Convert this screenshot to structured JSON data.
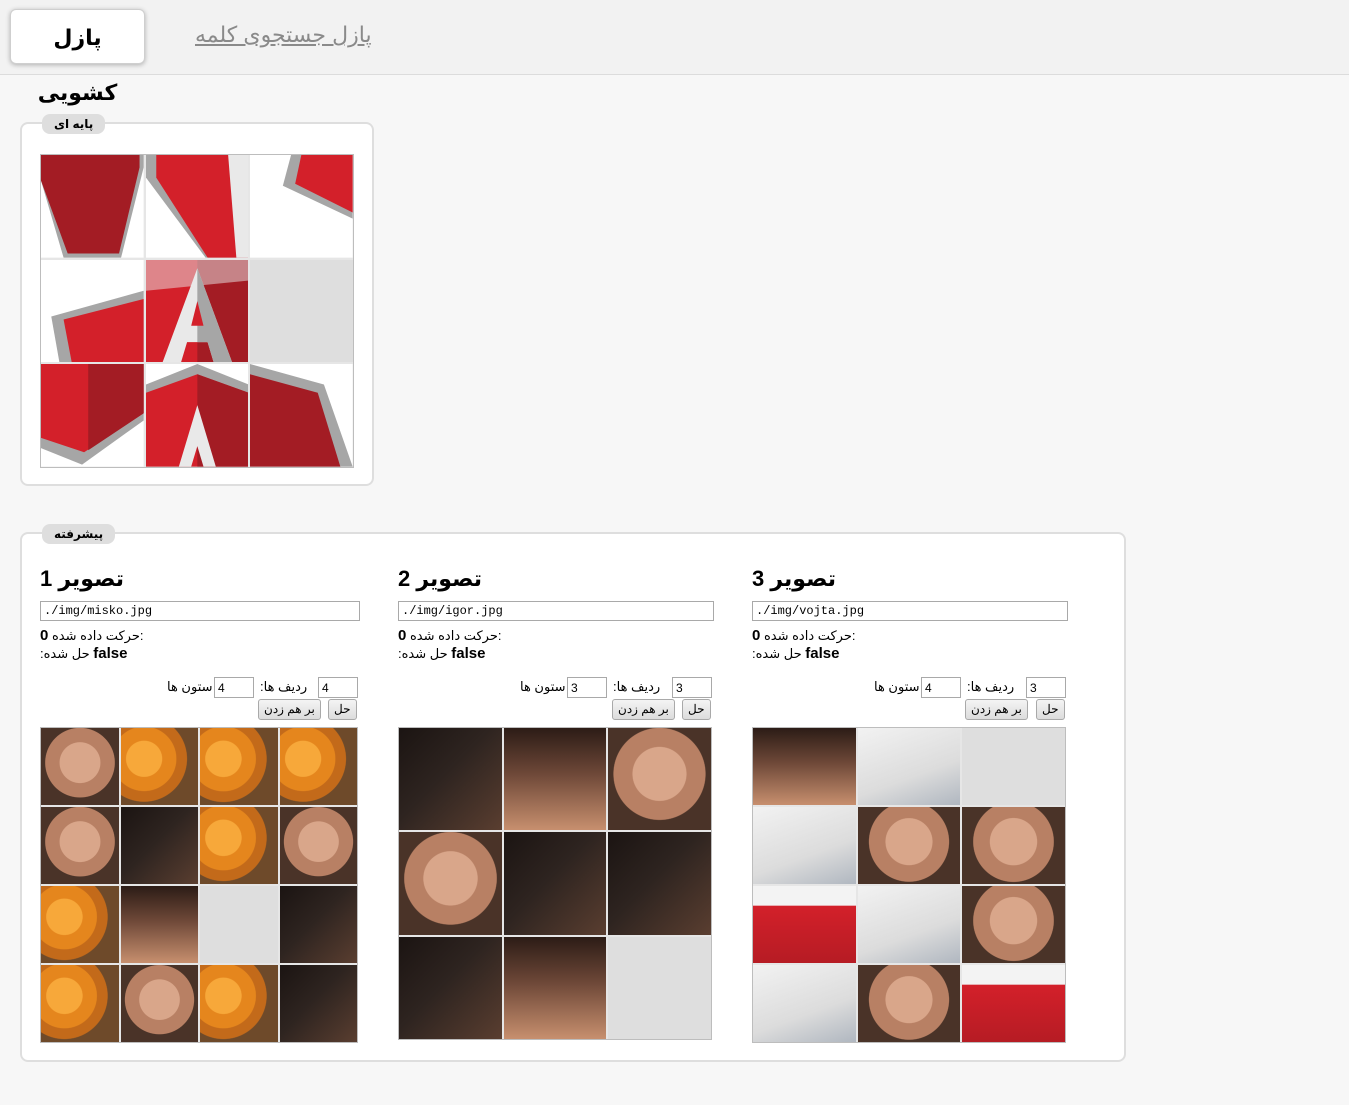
{
  "nav": {
    "active_tab": "پازل کشویی",
    "word_search_link": "پازل جستجوی کلمه"
  },
  "basic": {
    "legend": "پایه ای"
  },
  "advanced": {
    "legend": "پیشرفته",
    "moves_label": "حرکت داده شده:",
    "solved_label": ":حل شده",
    "rows_label": ":ردیف ها",
    "cols_label": "ستون ها",
    "shuffle_button": "بر هم زدن",
    "solve_button": "حل",
    "puzzles": [
      {
        "title": "تصویر 1",
        "path": "./img/misko.jpg",
        "moves": "0",
        "solved": "false",
        "rows": "4",
        "cols": "4"
      },
      {
        "title": "تصویر 2",
        "path": "./img/igor.jpg",
        "moves": "0",
        "solved": "false",
        "rows": "3",
        "cols": "3"
      },
      {
        "title": "تصویر 3",
        "path": "./img/vojta.jpg",
        "moves": "0",
        "solved": "false",
        "rows": "3",
        "cols": "4"
      }
    ]
  },
  "colors": {
    "angular_red": "#d3202a",
    "angular_dark_red": "#a31c24",
    "angular_gray": "#a6a6a6",
    "empty_tile": "#dedede"
  }
}
